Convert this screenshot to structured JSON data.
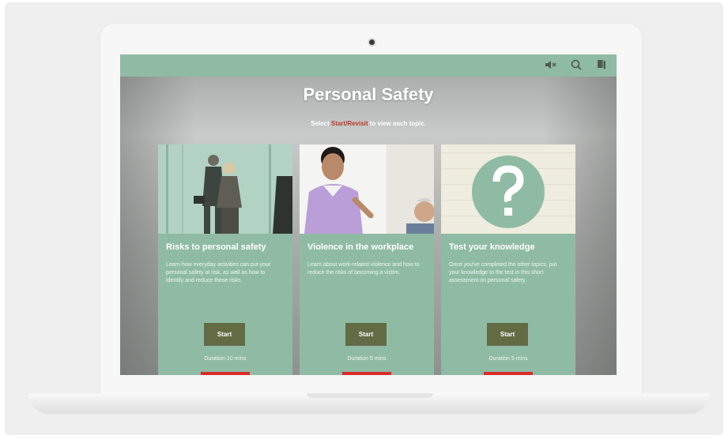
{
  "course": {
    "title": "Personal Safety",
    "instruction_prefix": "Select ",
    "instruction_highlight": "Start/Revisit",
    "instruction_suffix": " to view each topic."
  },
  "toolbar": {
    "icons": [
      "mute-icon",
      "search-icon",
      "book-icon"
    ]
  },
  "cards": [
    {
      "title": "Risks to personal safety",
      "description": "Learn how everyday activities can put your personal safety at risk, as well as how to identify and reduce these risks.",
      "button_label": "Start",
      "duration": "Duration 10 mins"
    },
    {
      "title": "Violence in the workplace",
      "description": "Learn about work-related violence and how to reduce the risks of becoming a victim.",
      "button_label": "Start",
      "duration": "Duration 5 mins"
    },
    {
      "title": "Test your knowledge",
      "description": "Once you've completed the other topics, put your knowledge to the test in this short assessment on personal safety.",
      "button_label": "Start",
      "duration": "Duration 5 mins"
    }
  ],
  "colors": {
    "accent": "#8fbba4",
    "button": "#636b44",
    "highlight": "#c0392b",
    "progress": "#d92b2b"
  }
}
